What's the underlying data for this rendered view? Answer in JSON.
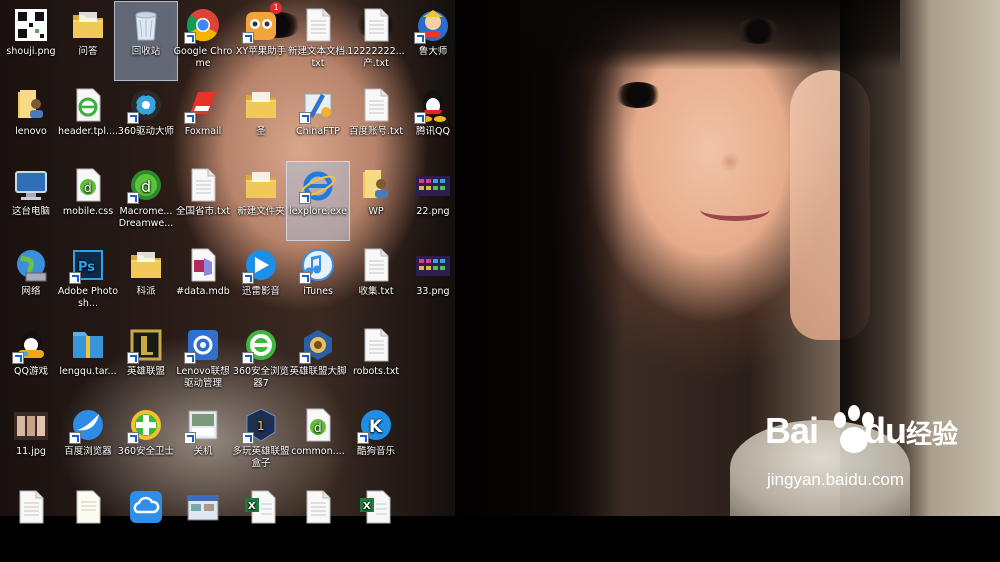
{
  "desktop": {
    "icons": [
      {
        "id": "shouji",
        "label": "shouji.png",
        "type": "qrcode"
      },
      {
        "id": "wenda",
        "label": "问答",
        "type": "folder"
      },
      {
        "id": "recycle",
        "label": "回收站",
        "type": "recycle",
        "selected": true
      },
      {
        "id": "chrome",
        "label": "Google Chrome",
        "type": "chrome",
        "shortcut": true
      },
      {
        "id": "xy",
        "label": "XY苹果助手",
        "type": "xy",
        "shortcut": true,
        "badge": "1"
      },
      {
        "id": "newtxt1",
        "label": "新建文本文档.txt",
        "type": "txt"
      },
      {
        "id": "num_txt",
        "label": "12222222...产.txt",
        "type": "txt"
      },
      {
        "id": "ludashi",
        "label": "鲁大师",
        "type": "ludashi",
        "shortcut": true
      },
      {
        "id": "lenovo",
        "label": "lenovo",
        "type": "userfolder"
      },
      {
        "id": "header",
        "label": "header.tpl....",
        "type": "ie_doc"
      },
      {
        "id": "driver360",
        "label": "360驱动大师",
        "type": "gear360",
        "shortcut": true
      },
      {
        "id": "foxmail",
        "label": "Foxmail",
        "type": "foxmail",
        "shortcut": true
      },
      {
        "id": "sheng",
        "label": "圣",
        "type": "folder"
      },
      {
        "id": "chinaftp",
        "label": "ChinaFTP",
        "type": "chinaftp",
        "shortcut": true
      },
      {
        "id": "baidu_acct",
        "label": "百度账号.txt",
        "type": "txt"
      },
      {
        "id": "qq",
        "label": "腾讯QQ",
        "type": "qq",
        "shortcut": true
      },
      {
        "id": "thispc",
        "label": "这台电脑",
        "type": "computer"
      },
      {
        "id": "mobilecss",
        "label": "mobile.css",
        "type": "dw_doc"
      },
      {
        "id": "dreamweaver",
        "label": "Macrome... Dreamwe...",
        "type": "dreamweaver",
        "shortcut": true
      },
      {
        "id": "quanguo",
        "label": "全国省市.txt",
        "type": "txt"
      },
      {
        "id": "newfolder",
        "label": "新建文件夹",
        "type": "folder"
      },
      {
        "id": "iexplore",
        "label": "iexplore.exe",
        "type": "ie",
        "shortcut": true,
        "selected": true
      },
      {
        "id": "wp",
        "label": "WP",
        "type": "userfolder"
      },
      {
        "id": "png22",
        "label": "22.png",
        "type": "screenshot"
      },
      {
        "id": "network",
        "label": "网络",
        "type": "network"
      },
      {
        "id": "photoshop",
        "label": "Adobe Photosh...",
        "type": "photoshop",
        "shortcut": true
      },
      {
        "id": "kepai",
        "label": "科派",
        "type": "folder"
      },
      {
        "id": "datamdb",
        "label": "#data.mdb",
        "type": "mdb"
      },
      {
        "id": "xunlei",
        "label": "迅雷影音",
        "type": "xunlei",
        "shortcut": true
      },
      {
        "id": "itunes",
        "label": "iTunes",
        "type": "itunes",
        "shortcut": true
      },
      {
        "id": "shouji_txt",
        "label": "收集.txt",
        "type": "txt"
      },
      {
        "id": "png33",
        "label": "33.png",
        "type": "screenshot"
      },
      {
        "id": "qqgame",
        "label": "QQ游戏",
        "type": "qqgame",
        "shortcut": true
      },
      {
        "id": "lengqu",
        "label": "lengqu.tar...",
        "type": "archive"
      },
      {
        "id": "lol",
        "label": "英雄联盟",
        "type": "lol",
        "shortcut": true
      },
      {
        "id": "lenovo_drv",
        "label": "Lenovo联想驱动管理",
        "type": "lenovo_drv",
        "shortcut": true
      },
      {
        "id": "browser360",
        "label": "360安全浏览器7",
        "type": "ie360",
        "shortcut": true
      },
      {
        "id": "lolhelper",
        "label": "英雄联盟大脚",
        "type": "lolhelper",
        "shortcut": true
      },
      {
        "id": "robots",
        "label": "robots.txt",
        "type": "txt"
      },
      {
        "id": "jpg11",
        "label": "11.jpg",
        "type": "photo"
      },
      {
        "id": "baidubrowser",
        "label": "百度浏览器",
        "type": "baidubrowser",
        "shortcut": true
      },
      {
        "id": "guard360",
        "label": "360安全卫士",
        "type": "guard360",
        "shortcut": true
      },
      {
        "id": "guanji",
        "label": "关机",
        "type": "shutdown",
        "shortcut": true
      },
      {
        "id": "duowan",
        "label": "多玩英雄联盟盒子",
        "type": "duowan",
        "shortcut": true
      },
      {
        "id": "common",
        "label": "common....",
        "type": "dw_doc"
      },
      {
        "id": "kugou",
        "label": "酷狗音乐",
        "type": "kugou",
        "shortcut": true
      },
      {
        "id": "r7_1",
        "label": "",
        "type": "txt"
      },
      {
        "id": "r7_2",
        "label": "",
        "type": "doc"
      },
      {
        "id": "r7_3",
        "label": "",
        "type": "cloud"
      },
      {
        "id": "r7_4",
        "label": "",
        "type": "window"
      },
      {
        "id": "r7_5",
        "label": "",
        "type": "excel"
      },
      {
        "id": "r7_6",
        "label": "",
        "type": "txt"
      },
      {
        "id": "r7_7",
        "label": "",
        "type": "excel"
      }
    ]
  },
  "watermark": {
    "brand": "Bai",
    "brand_tail": "du",
    "cn": "经验",
    "url": "jingyan.baidu.com"
  },
  "colors": {
    "selection": "#aac8eb",
    "accent_blue": "#1a5fc7"
  }
}
